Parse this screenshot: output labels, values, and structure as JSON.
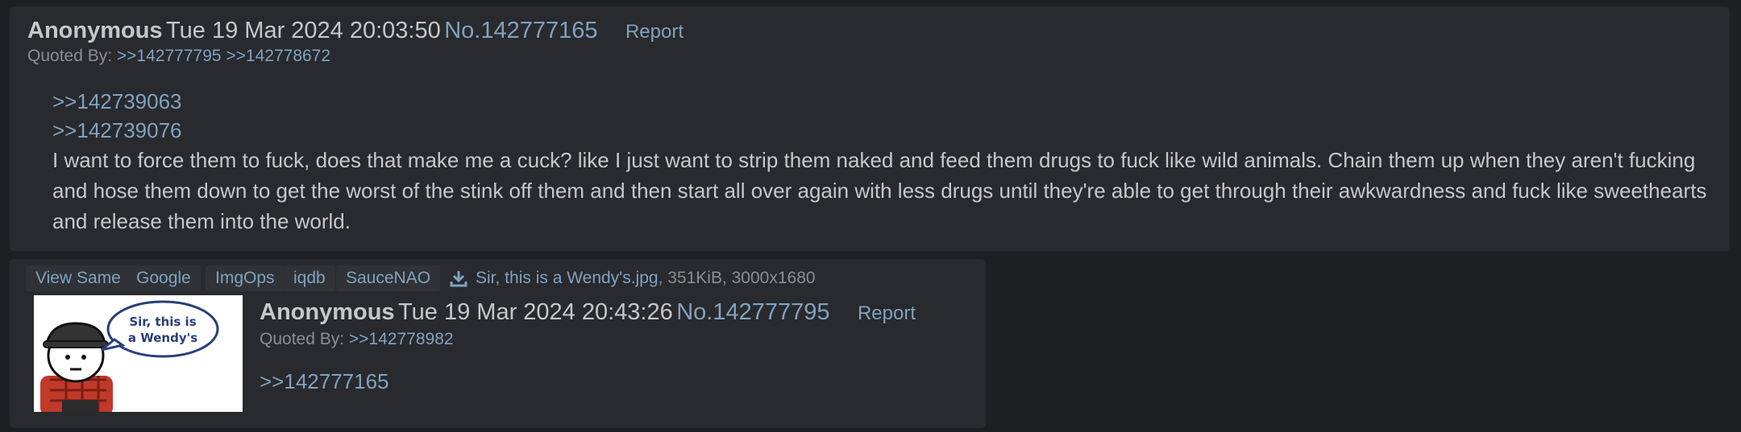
{
  "post1": {
    "name": "Anonymous",
    "datetime": "Tue 19 Mar 2024 20:03:50",
    "number": "No.142777165",
    "report": "Report",
    "quoted_by_label": "Quoted By:",
    "quoted_by": [
      ">>142777795",
      ">>142778672"
    ],
    "quote_links": [
      ">>142739063",
      ">>142739076"
    ],
    "body": "I want to force them to fuck, does that make me a cuck? like I just want to strip them naked and feed them drugs to fuck like wild animals. Chain them up when they aren't fucking and hose them down to get the worst of the stink off them and then start all over again with less drugs until they're able to get through their awkwardness and fuck like sweethearts and release them into the world."
  },
  "post2": {
    "tools": [
      "View Same",
      "Google",
      "ImgOps",
      "iqdb",
      "SauceNAO"
    ],
    "file": {
      "name": "Sir, this is a Wendy's.jpg",
      "meta": ", 351KiB, 3000x1680"
    },
    "thumbnail_text": "Sir, this is a Wendy's",
    "name": "Anonymous",
    "datetime": "Tue 19 Mar 2024 20:43:26",
    "number": "No.142777795",
    "report": "Report",
    "quoted_by_label": "Quoted By:",
    "quoted_by": [
      ">>142778982"
    ],
    "quote_links": [
      ">>142777165"
    ]
  },
  "colors": {
    "page_bg": "#1d1f21",
    "post_bg": "#282a2e",
    "text": "#c5c8c6",
    "link": "#81a2be",
    "muted": "#8a8d91"
  }
}
